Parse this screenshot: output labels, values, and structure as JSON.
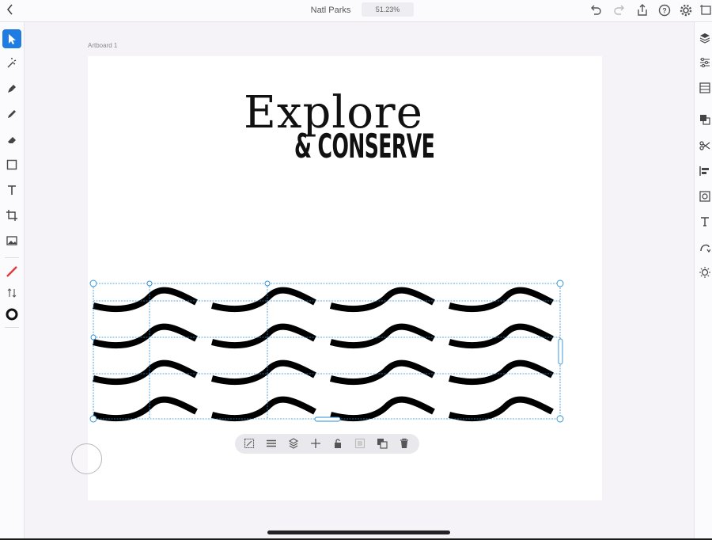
{
  "header": {
    "title": "Natl Parks",
    "zoom": "51.23%",
    "icons": [
      "back-chevron-icon",
      "undo-icon",
      "redo-icon",
      "share-icon",
      "help-icon",
      "settings-icon",
      "artboards-icon"
    ]
  },
  "left_toolbar": {
    "tools": [
      "selection-icon",
      "direct-select-icon",
      "pen-icon",
      "pencil-icon",
      "eraser-icon",
      "shape-icon",
      "type-icon",
      "crop-icon",
      "place-image-icon",
      "stroke-color-icon",
      "swap-icon",
      "fill-color-icon"
    ]
  },
  "right_panel": {
    "icons": [
      "layers-icon",
      "properties-icon",
      "libraries-icon",
      "arrange-icon",
      "path-icon",
      "align-icon",
      "repeat-icon",
      "type-panel-icon",
      "warp-icon",
      "effects-icon"
    ]
  },
  "canvas": {
    "artboard_label": "Artboard 1",
    "headline_line1": "Explore",
    "headline_line2": "& CONSERVE",
    "pattern": {
      "rows": 4,
      "columns": 4,
      "color": "#000000",
      "selection_color": "#2b8fd6"
    }
  },
  "context_toolbar": {
    "icons": [
      "transform-icon",
      "align-lines-icon",
      "layer-stack-icon",
      "move-icon",
      "lock-icon",
      "group-icon",
      "duplicate-icon",
      "delete-icon"
    ]
  },
  "colors": {
    "accent": "#1f7ce3",
    "stroke_color": "#e03a3a",
    "background": "#f6f3f8"
  }
}
